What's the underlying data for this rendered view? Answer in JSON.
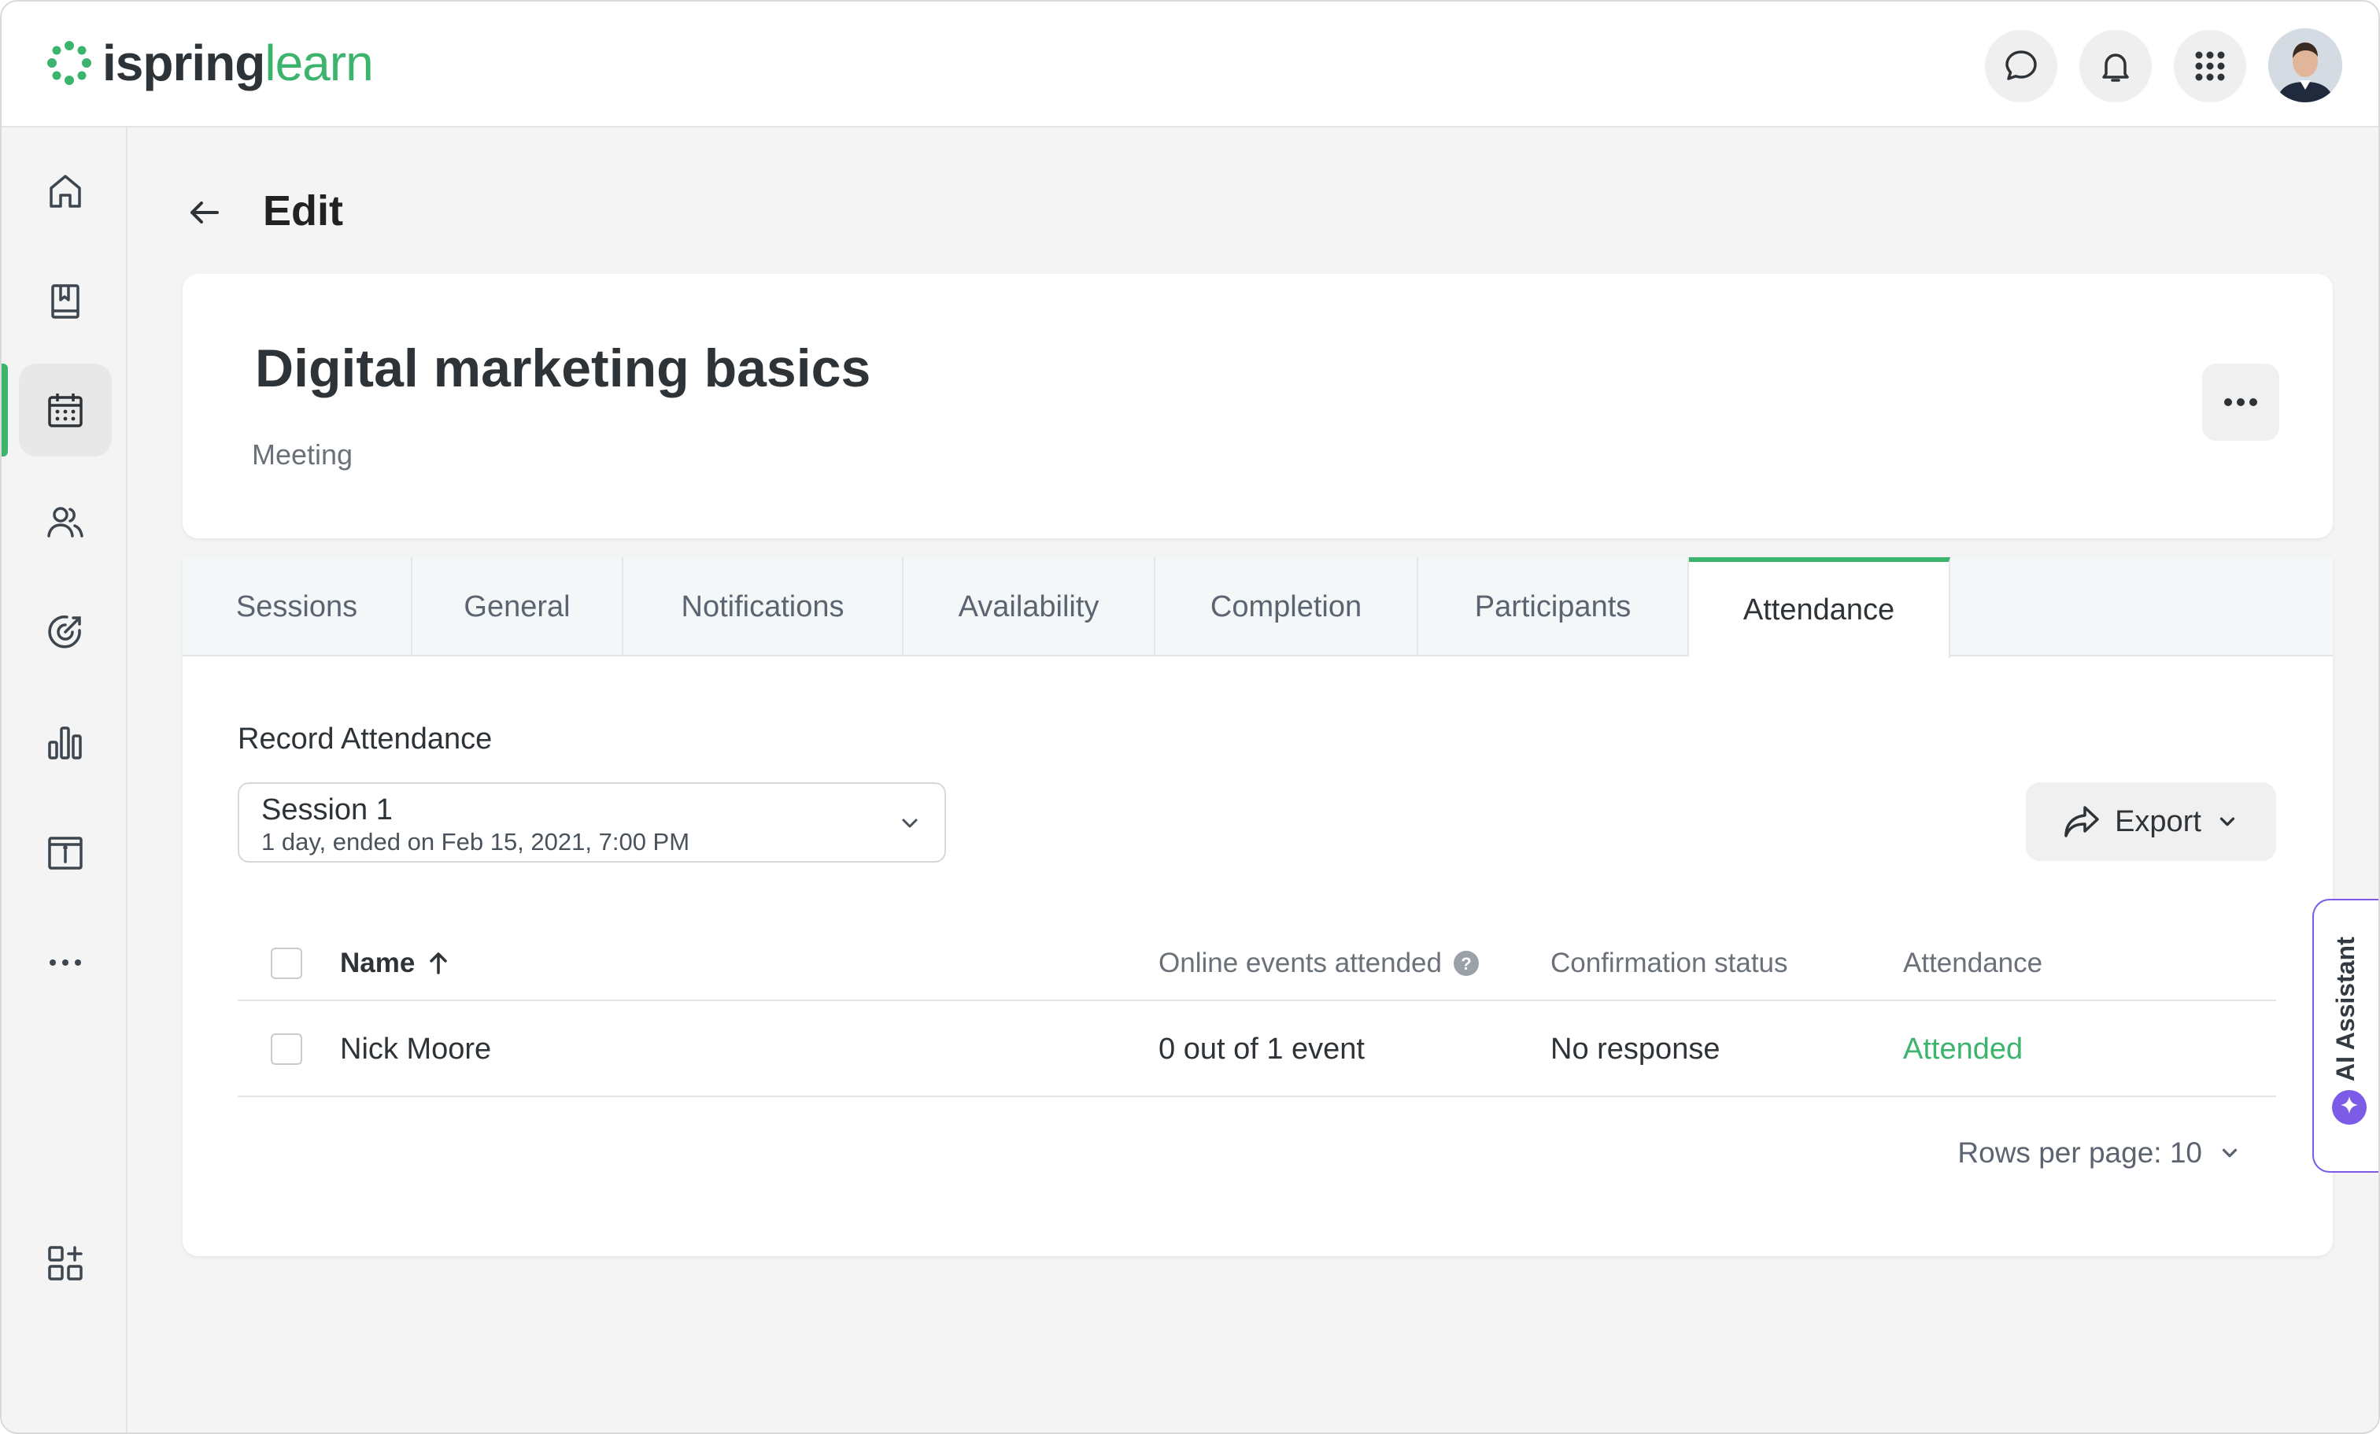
{
  "brand": {
    "word1": "ispring",
    "word2": "learn",
    "accent_color": "#3cb46e"
  },
  "header": {
    "icons": [
      "chat-icon",
      "bell-icon",
      "apps-grid-icon"
    ],
    "avatar": "user-avatar"
  },
  "sidebar": {
    "items": [
      "home",
      "library",
      "calendar",
      "users",
      "goals",
      "reports",
      "info",
      "more"
    ],
    "active": "calendar",
    "bottom": "add-widget"
  },
  "page": {
    "title": "Edit"
  },
  "course": {
    "title": "Digital marketing basics",
    "type": "Meeting"
  },
  "tabs": [
    "Sessions",
    "General",
    "Notifications",
    "Availability",
    "Completion",
    "Participants",
    "Attendance"
  ],
  "active_tab": "Attendance",
  "attendance": {
    "label": "Record Attendance",
    "session": {
      "name": "Session 1",
      "detail": "1 day, ended on Feb 15, 2021, 7:00 PM"
    },
    "export_label": "Export",
    "columns": {
      "name": "Name",
      "online": "Online events attended",
      "confirmation": "Confirmation status",
      "attendance": "Attendance"
    },
    "rows": [
      {
        "name": "Nick Moore",
        "online": "0 out of 1 event",
        "confirmation": "No response",
        "attendance": "Attended"
      }
    ],
    "attended_color": "#3cb46e",
    "rows_per_page": "Rows per page: 10"
  },
  "ai_assistant": {
    "label": "AI Assistant",
    "color": "#7c5ce6"
  }
}
